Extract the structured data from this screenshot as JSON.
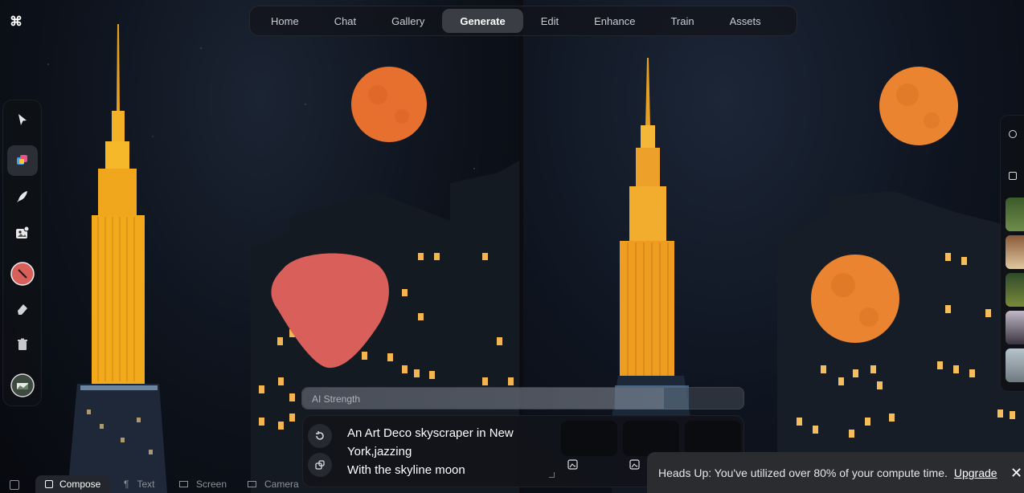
{
  "app": {
    "logo_glyph": "⌘"
  },
  "nav": {
    "tabs": [
      {
        "label": "Home",
        "active": false
      },
      {
        "label": "Chat",
        "active": false
      },
      {
        "label": "Gallery",
        "active": false
      },
      {
        "label": "Generate",
        "active": true
      },
      {
        "label": "Edit",
        "active": false
      },
      {
        "label": "Enhance",
        "active": false
      },
      {
        "label": "Train",
        "active": false
      },
      {
        "label": "Assets",
        "active": false
      }
    ]
  },
  "toolbar": {
    "tools": [
      {
        "icon": "cursor-icon"
      },
      {
        "icon": "shapes-icon",
        "selected": true
      },
      {
        "icon": "brush-icon"
      },
      {
        "icon": "image-add-icon"
      },
      {
        "icon": "color-picker-icon"
      },
      {
        "icon": "eraser-icon"
      },
      {
        "icon": "trash-icon"
      },
      {
        "icon": "reference-image-icon"
      }
    ]
  },
  "ai_strength": {
    "label": "AI Strength",
    "value": 0.82
  },
  "prompt": {
    "text": "An Art Deco skyscraper in New York,jazzing\n With the skyline moon"
  },
  "modes": {
    "compose": "Compose",
    "text": "Text",
    "screen": "Screen",
    "camera": "Camera"
  },
  "banner": {
    "message": "Heads Up: You've utilized over 80% of your compute time.",
    "link": "Upgrade",
    "close": "✕"
  },
  "colors": {
    "accent_active_tab": "#3a3d44",
    "moon": "#e8702e",
    "tower_gold": "#f0a81e",
    "paint_mask": "#d9605a"
  }
}
